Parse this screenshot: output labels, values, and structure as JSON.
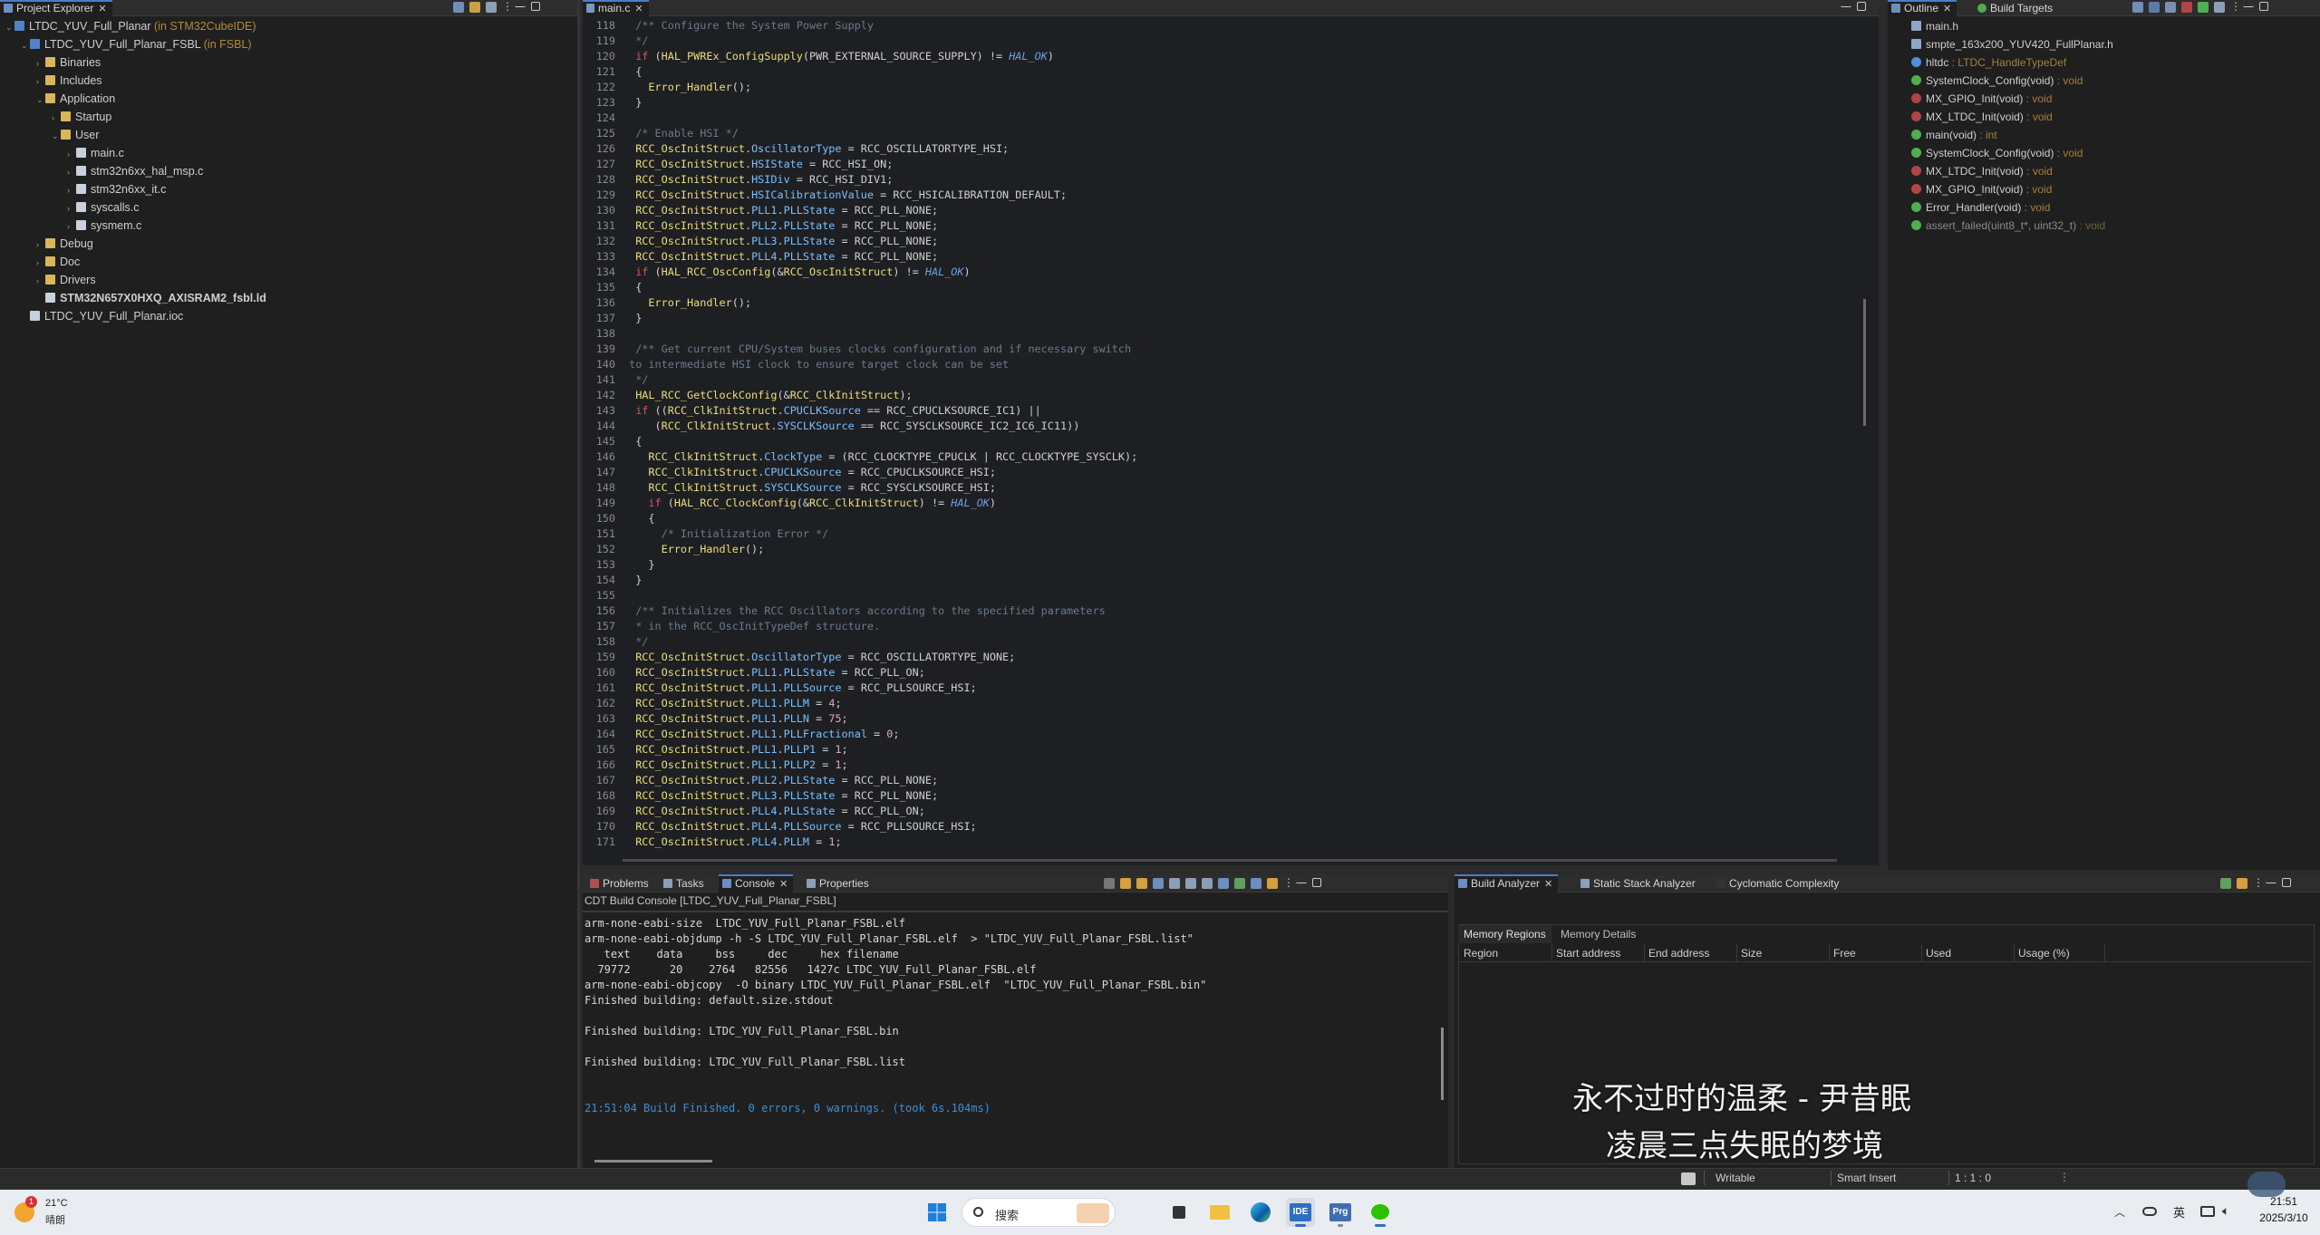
{
  "project_explorer": {
    "tab_label": "Project Explorer",
    "items": [
      {
        "label": "LTDC_YUV_Full_Planar",
        "suffix": " (in STM32CubeIDE)",
        "level": 0,
        "twisty": "v"
      },
      {
        "label": "LTDC_YUV_Full_Planar_FSBL",
        "suffix": " (in FSBL)",
        "level": 1,
        "twisty": "v"
      },
      {
        "label": "Binaries",
        "suffix": "",
        "level": 2,
        "twisty": ">"
      },
      {
        "label": "Includes",
        "suffix": "",
        "level": 2,
        "twisty": ">"
      },
      {
        "label": "Application",
        "suffix": "",
        "level": 2,
        "twisty": "v"
      },
      {
        "label": "Startup",
        "suffix": "",
        "level": 3,
        "twisty": ">"
      },
      {
        "label": "User",
        "suffix": "",
        "level": 3,
        "twisty": "v"
      },
      {
        "label": "main.c",
        "suffix": "",
        "level": 4,
        "twisty": ">"
      },
      {
        "label": "stm32n6xx_hal_msp.c",
        "suffix": "",
        "level": 4,
        "twisty": ">"
      },
      {
        "label": "stm32n6xx_it.c",
        "suffix": "",
        "level": 4,
        "twisty": ">"
      },
      {
        "label": "syscalls.c",
        "suffix": "",
        "level": 4,
        "twisty": ">"
      },
      {
        "label": "sysmem.c",
        "suffix": "",
        "level": 4,
        "twisty": ">"
      },
      {
        "label": "Debug",
        "suffix": "",
        "level": 2,
        "twisty": ">"
      },
      {
        "label": "Doc",
        "suffix": "",
        "level": 2,
        "twisty": ">"
      },
      {
        "label": "Drivers",
        "suffix": "",
        "level": 2,
        "twisty": ">"
      },
      {
        "label": "STM32N657X0HXQ_AXISRAM2_fsbl.ld",
        "suffix": "",
        "level": 2,
        "twisty": ""
      },
      {
        "label": "LTDC_YUV_Full_Planar.ioc",
        "suffix": "",
        "level": 1,
        "twisty": ""
      }
    ]
  },
  "editor": {
    "tab_label": "main.c",
    "first_line": 118,
    "lines": [
      [
        [
          "cm",
          "  /** Configure the System Power Supply"
        ]
      ],
      [
        [
          "cm",
          "  */"
        ]
      ],
      [
        [
          "kw",
          "  if"
        ],
        [
          "id",
          " ("
        ],
        [
          "fn",
          "HAL_PWREx_ConfigSupply"
        ],
        [
          "id",
          "(PWR_EXTERNAL_SOURCE_SUPPLY) != "
        ],
        [
          "it",
          "HAL_OK"
        ],
        [
          "id",
          ")"
        ]
      ],
      [
        [
          "id",
          "  {"
        ]
      ],
      [
        [
          "fn",
          "    Error_Handler"
        ],
        [
          "id",
          "();"
        ]
      ],
      [
        [
          "id",
          "  }"
        ]
      ],
      [
        [
          "id",
          ""
        ]
      ],
      [
        [
          "cm",
          "  /* Enable HSI */"
        ]
      ],
      [
        [
          "fn",
          "  RCC_OscInitStruct"
        ],
        [
          "id",
          "."
        ],
        [
          "st",
          "OscillatorType"
        ],
        [
          "id",
          " = RCC_OSCILLATORTYPE_HSI;"
        ]
      ],
      [
        [
          "fn",
          "  RCC_OscInitStruct"
        ],
        [
          "id",
          "."
        ],
        [
          "st",
          "HSIState"
        ],
        [
          "id",
          " = RCC_HSI_ON;"
        ]
      ],
      [
        [
          "fn",
          "  RCC_OscInitStruct"
        ],
        [
          "id",
          "."
        ],
        [
          "st",
          "HSIDiv"
        ],
        [
          "id",
          " = RCC_HSI_DIV1;"
        ]
      ],
      [
        [
          "fn",
          "  RCC_OscInitStruct"
        ],
        [
          "id",
          "."
        ],
        [
          "st",
          "HSICalibrationValue"
        ],
        [
          "id",
          " = RCC_HSICALIBRATION_DEFAULT;"
        ]
      ],
      [
        [
          "fn",
          "  RCC_OscInitStruct"
        ],
        [
          "id",
          "."
        ],
        [
          "st",
          "PLL1"
        ],
        [
          "id",
          "."
        ],
        [
          "st",
          "PLLState"
        ],
        [
          "id",
          " = RCC_PLL_NONE;"
        ]
      ],
      [
        [
          "fn",
          "  RCC_OscInitStruct"
        ],
        [
          "id",
          "."
        ],
        [
          "st",
          "PLL2"
        ],
        [
          "id",
          "."
        ],
        [
          "st",
          "PLLState"
        ],
        [
          "id",
          " = RCC_PLL_NONE;"
        ]
      ],
      [
        [
          "fn",
          "  RCC_OscInitStruct"
        ],
        [
          "id",
          "."
        ],
        [
          "st",
          "PLL3"
        ],
        [
          "id",
          "."
        ],
        [
          "st",
          "PLLState"
        ],
        [
          "id",
          " = RCC_PLL_NONE;"
        ]
      ],
      [
        [
          "fn",
          "  RCC_OscInitStruct"
        ],
        [
          "id",
          "."
        ],
        [
          "st",
          "PLL4"
        ],
        [
          "id",
          "."
        ],
        [
          "st",
          "PLLState"
        ],
        [
          "id",
          " = RCC_PLL_NONE;"
        ]
      ],
      [
        [
          "kw",
          "  if"
        ],
        [
          "id",
          " ("
        ],
        [
          "fn",
          "HAL_RCC_OscConfig"
        ],
        [
          "id",
          "(&"
        ],
        [
          "fn",
          "RCC_OscInitStruct"
        ],
        [
          "id",
          ") != "
        ],
        [
          "it",
          "HAL_OK"
        ],
        [
          "id",
          ")"
        ]
      ],
      [
        [
          "id",
          "  {"
        ]
      ],
      [
        [
          "fn",
          "    Error_Handler"
        ],
        [
          "id",
          "();"
        ]
      ],
      [
        [
          "id",
          "  }"
        ]
      ],
      [
        [
          "id",
          ""
        ]
      ],
      [
        [
          "cm",
          "  /** Get current CPU/System buses clocks configuration and if necessary switch"
        ]
      ],
      [
        [
          "cm",
          " to intermediate HSI clock to ensure target clock can be set"
        ]
      ],
      [
        [
          "cm",
          "  */"
        ]
      ],
      [
        [
          "fn",
          "  HAL_RCC_GetClockConfig"
        ],
        [
          "id",
          "(&"
        ],
        [
          "fn",
          "RCC_ClkInitStruct"
        ],
        [
          "id",
          ");"
        ]
      ],
      [
        [
          "kw",
          "  if"
        ],
        [
          "id",
          " (("
        ],
        [
          "fn",
          "RCC_ClkInitStruct"
        ],
        [
          "id",
          "."
        ],
        [
          "st",
          "CPUCLKSource"
        ],
        [
          "id",
          " == RCC_CPUCLKSOURCE_IC1) ||"
        ]
      ],
      [
        [
          "id",
          "     ("
        ],
        [
          "fn",
          "RCC_ClkInitStruct"
        ],
        [
          "id",
          "."
        ],
        [
          "st",
          "SYSCLKSource"
        ],
        [
          "id",
          " == RCC_SYSCLKSOURCE_IC2_IC6_IC11))"
        ]
      ],
      [
        [
          "id",
          "  {"
        ]
      ],
      [
        [
          "fn",
          "    RCC_ClkInitStruct"
        ],
        [
          "id",
          "."
        ],
        [
          "st",
          "ClockType"
        ],
        [
          "id",
          " = (RCC_CLOCKTYPE_CPUCLK | RCC_CLOCKTYPE_SYSCLK);"
        ]
      ],
      [
        [
          "fn",
          "    RCC_ClkInitStruct"
        ],
        [
          "id",
          "."
        ],
        [
          "st",
          "CPUCLKSource"
        ],
        [
          "id",
          " = RCC_CPUCLKSOURCE_HSI;"
        ]
      ],
      [
        [
          "fn",
          "    RCC_ClkInitStruct"
        ],
        [
          "id",
          "."
        ],
        [
          "st",
          "SYSCLKSource"
        ],
        [
          "id",
          " = RCC_SYSCLKSOURCE_HSI;"
        ]
      ],
      [
        [
          "kw",
          "    if"
        ],
        [
          "id",
          " ("
        ],
        [
          "fn",
          "HAL_RCC_ClockConfig"
        ],
        [
          "id",
          "(&"
        ],
        [
          "fn",
          "RCC_ClkInitStruct"
        ],
        [
          "id",
          ") != "
        ],
        [
          "it",
          "HAL_OK"
        ],
        [
          "id",
          ")"
        ]
      ],
      [
        [
          "id",
          "    {"
        ]
      ],
      [
        [
          "cm",
          "      /* Initialization Error */"
        ]
      ],
      [
        [
          "fn",
          "      Error_Handler"
        ],
        [
          "id",
          "();"
        ]
      ],
      [
        [
          "id",
          "    }"
        ]
      ],
      [
        [
          "id",
          "  }"
        ]
      ],
      [
        [
          "id",
          ""
        ]
      ],
      [
        [
          "cm",
          "  /** Initializes the RCC Oscillators according to the specified parameters"
        ]
      ],
      [
        [
          "cm",
          "  * in the RCC_OscInitTypeDef structure."
        ]
      ],
      [
        [
          "cm",
          "  */"
        ]
      ],
      [
        [
          "fn",
          "  RCC_OscInitStruct"
        ],
        [
          "id",
          "."
        ],
        [
          "st",
          "OscillatorType"
        ],
        [
          "id",
          " = RCC_OSCILLATORTYPE_NONE;"
        ]
      ],
      [
        [
          "fn",
          "  RCC_OscInitStruct"
        ],
        [
          "id",
          "."
        ],
        [
          "st",
          "PLL1"
        ],
        [
          "id",
          "."
        ],
        [
          "st",
          "PLLState"
        ],
        [
          "id",
          " = RCC_PLL_ON;"
        ]
      ],
      [
        [
          "fn",
          "  RCC_OscInitStruct"
        ],
        [
          "id",
          "."
        ],
        [
          "st",
          "PLL1"
        ],
        [
          "id",
          "."
        ],
        [
          "st",
          "PLLSource"
        ],
        [
          "id",
          " = RCC_PLLSOURCE_HSI;"
        ]
      ],
      [
        [
          "fn",
          "  RCC_OscInitStruct"
        ],
        [
          "id",
          "."
        ],
        [
          "st",
          "PLL1"
        ],
        [
          "id",
          "."
        ],
        [
          "st",
          "PLLM"
        ],
        [
          "id",
          " = "
        ],
        [
          "num",
          "4"
        ],
        [
          "id",
          ";"
        ]
      ],
      [
        [
          "fn",
          "  RCC_OscInitStruct"
        ],
        [
          "id",
          "."
        ],
        [
          "st",
          "PLL1"
        ],
        [
          "id",
          "."
        ],
        [
          "st",
          "PLLN"
        ],
        [
          "id",
          " = "
        ],
        [
          "num",
          "75"
        ],
        [
          "id",
          ";"
        ]
      ],
      [
        [
          "fn",
          "  RCC_OscInitStruct"
        ],
        [
          "id",
          "."
        ],
        [
          "st",
          "PLL1"
        ],
        [
          "id",
          "."
        ],
        [
          "st",
          "PLLFractional"
        ],
        [
          "id",
          " = "
        ],
        [
          "num",
          "0"
        ],
        [
          "id",
          ";"
        ]
      ],
      [
        [
          "fn",
          "  RCC_OscInitStruct"
        ],
        [
          "id",
          "."
        ],
        [
          "st",
          "PLL1"
        ],
        [
          "id",
          "."
        ],
        [
          "st",
          "PLLP1"
        ],
        [
          "id",
          " = "
        ],
        [
          "num",
          "1"
        ],
        [
          "id",
          ";"
        ]
      ],
      [
        [
          "fn",
          "  RCC_OscInitStruct"
        ],
        [
          "id",
          "."
        ],
        [
          "st",
          "PLL1"
        ],
        [
          "id",
          "."
        ],
        [
          "st",
          "PLLP2"
        ],
        [
          "id",
          " = "
        ],
        [
          "num",
          "1"
        ],
        [
          "id",
          ";"
        ]
      ],
      [
        [
          "fn",
          "  RCC_OscInitStruct"
        ],
        [
          "id",
          "."
        ],
        [
          "st",
          "PLL2"
        ],
        [
          "id",
          "."
        ],
        [
          "st",
          "PLLState"
        ],
        [
          "id",
          " = RCC_PLL_NONE;"
        ]
      ],
      [
        [
          "fn",
          "  RCC_OscInitStruct"
        ],
        [
          "id",
          "."
        ],
        [
          "st",
          "PLL3"
        ],
        [
          "id",
          "."
        ],
        [
          "st",
          "PLLState"
        ],
        [
          "id",
          " = RCC_PLL_NONE;"
        ]
      ],
      [
        [
          "fn",
          "  RCC_OscInitStruct"
        ],
        [
          "id",
          "."
        ],
        [
          "st",
          "PLL4"
        ],
        [
          "id",
          "."
        ],
        [
          "st",
          "PLLState"
        ],
        [
          "id",
          " = RCC_PLL_ON;"
        ]
      ],
      [
        [
          "fn",
          "  RCC_OscInitStruct"
        ],
        [
          "id",
          "."
        ],
        [
          "st",
          "PLL4"
        ],
        [
          "id",
          "."
        ],
        [
          "st",
          "PLLSource"
        ],
        [
          "id",
          " = RCC_PLLSOURCE_HSI;"
        ]
      ],
      [
        [
          "fn",
          "  RCC_OscInitStruct"
        ],
        [
          "id",
          "."
        ],
        [
          "st",
          "PLL4"
        ],
        [
          "id",
          "."
        ],
        [
          "st",
          "PLLM"
        ],
        [
          "id",
          " = "
        ],
        [
          "num",
          "1"
        ],
        [
          "id",
          ";"
        ]
      ]
    ]
  },
  "outline": {
    "tab_label": "Outline",
    "tab2_label": "Build Targets",
    "items": [
      {
        "name": "main.h",
        "type": "",
        "icon": "#8fa6c7"
      },
      {
        "name": "smpte_163x200_YUV420_FullPlanar.h",
        "type": "",
        "icon": "#8fa6c7"
      },
      {
        "name": "hltdc",
        "type": " : LTDC_HandleTypeDef",
        "icon": "#4f8fd6"
      },
      {
        "name": "SystemClock_Config(void)",
        "type": " : void",
        "icon": "#4fae4f"
      },
      {
        "name": "MX_GPIO_Init(void)",
        "type": " : void",
        "icon": "#b04545"
      },
      {
        "name": "MX_LTDC_Init(void)",
        "type": " : void",
        "icon": "#b04545"
      },
      {
        "name": "main(void)",
        "type": " : int",
        "icon": "#4fae4f"
      },
      {
        "name": "SystemClock_Config(void)",
        "type": " : void",
        "icon": "#4fae4f"
      },
      {
        "name": "MX_LTDC_Init(void)",
        "type": " : void",
        "icon": "#b04545"
      },
      {
        "name": "MX_GPIO_Init(void)",
        "type": " : void",
        "icon": "#b04545"
      },
      {
        "name": "Error_Handler(void)",
        "type": " : void",
        "icon": "#4fae4f"
      },
      {
        "name": "assert_failed(uint8_t*, uint32_t)",
        "type": " : void",
        "icon": "#4fae4f",
        "dim": true
      }
    ]
  },
  "console": {
    "tabs": [
      "Problems",
      "Tasks",
      "Console",
      "Properties"
    ],
    "title": "CDT Build Console [LTDC_YUV_Full_Planar_FSBL]",
    "lines": [
      "arm-none-eabi-size  LTDC_YUV_Full_Planar_FSBL.elf",
      "arm-none-eabi-objdump -h -S LTDC_YUV_Full_Planar_FSBL.elf  > \"LTDC_YUV_Full_Planar_FSBL.list\"",
      "   text    data     bss     dec     hex filename",
      "  79772      20    2764   82556   1427c LTDC_YUV_Full_Planar_FSBL.elf",
      "arm-none-eabi-objcopy  -O binary LTDC_YUV_Full_Planar_FSBL.elf  \"LTDC_YUV_Full_Planar_FSBL.bin\"",
      "Finished building: default.size.stdout",
      "",
      "Finished building: LTDC_YUV_Full_Planar_FSBL.bin",
      "",
      "Finished building: LTDC_YUV_Full_Planar_FSBL.list",
      "",
      "",
      "21:51:04 Build Finished. 0 errors, 0 warnings. (took 6s.104ms)"
    ]
  },
  "build_analyzer": {
    "tabs": [
      "Build Analyzer",
      "Static Stack Analyzer",
      "Cyclomatic Complexity"
    ],
    "subtabs": [
      "Memory Regions",
      "Memory Details"
    ],
    "columns": [
      "Region",
      "Start address",
      "End address",
      "Size",
      "Free",
      "Used",
      "Usage (%)"
    ],
    "lyrics_line1": "永不过时的温柔 - 尹昔眠",
    "lyrics_line2": "凌晨三点失眠的梦境"
  },
  "statusbar": {
    "writable": "Writable",
    "insert_mode": "Smart Insert",
    "position": "1 : 1 : 0"
  },
  "taskbar": {
    "weather_temp": "21°C",
    "weather_desc": "晴朗",
    "weather_badge": "1",
    "search_placeholder": "搜索",
    "app_ide": "IDE",
    "app_prg": "Prg",
    "ime": "英",
    "time": "21:51",
    "date": "2025/3/10"
  }
}
